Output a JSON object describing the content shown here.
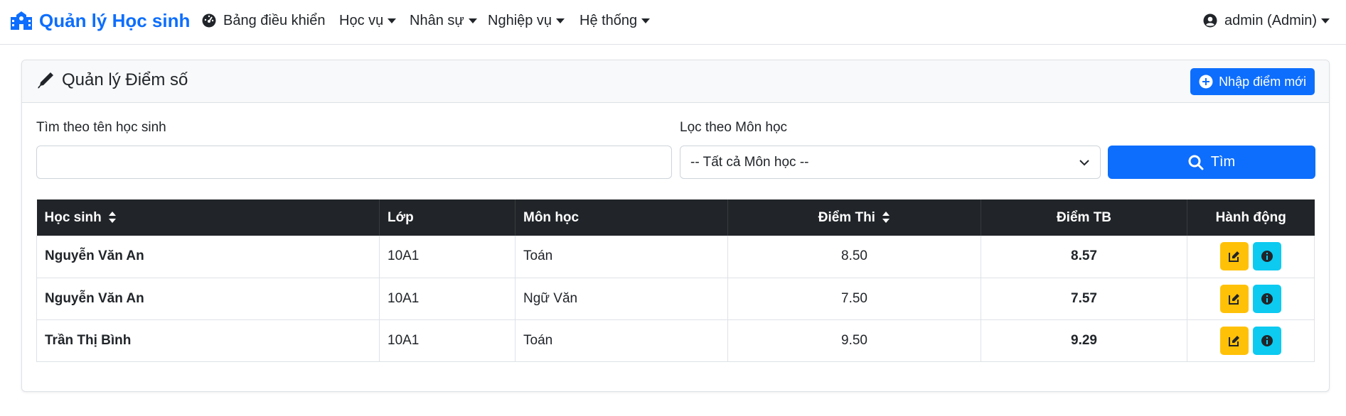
{
  "navbar": {
    "brand": "Quản lý Học sinh",
    "items": [
      {
        "label": "Bảng điều khiển"
      },
      {
        "label": "Học vụ"
      },
      {
        "label": "Nhân sự"
      },
      {
        "label": "Nghiệp vụ"
      },
      {
        "label": "Hệ thống"
      }
    ],
    "user": "admin (Admin)"
  },
  "card": {
    "title": "Quản lý Điểm số",
    "add_button": "Nhập điểm mới"
  },
  "filters": {
    "search_label": "Tìm theo tên học sinh",
    "search_value": "",
    "subject_label": "Lọc theo Môn học",
    "subject_selected": "-- Tất cả Môn học --",
    "search_button": "Tìm"
  },
  "table": {
    "headers": [
      "Học sinh",
      "Lớp",
      "Môn học",
      "Điểm Thi",
      "Điểm TB",
      "Hành động"
    ],
    "rows": [
      {
        "student": "Nguyễn Văn An",
        "class": "10A1",
        "subject": "Toán",
        "score": "8.50",
        "avg": "8.57"
      },
      {
        "student": "Nguyễn Văn An",
        "class": "10A1",
        "subject": "Ngữ Văn",
        "score": "7.50",
        "avg": "7.57"
      },
      {
        "student": "Trần Thị Bình",
        "class": "10A1",
        "subject": "Toán",
        "score": "9.50",
        "avg": "9.29"
      }
    ]
  },
  "colors": {
    "primary": "#0d6efd",
    "dark": "#212529",
    "warning": "#ffc107",
    "info": "#0dcaf0"
  }
}
